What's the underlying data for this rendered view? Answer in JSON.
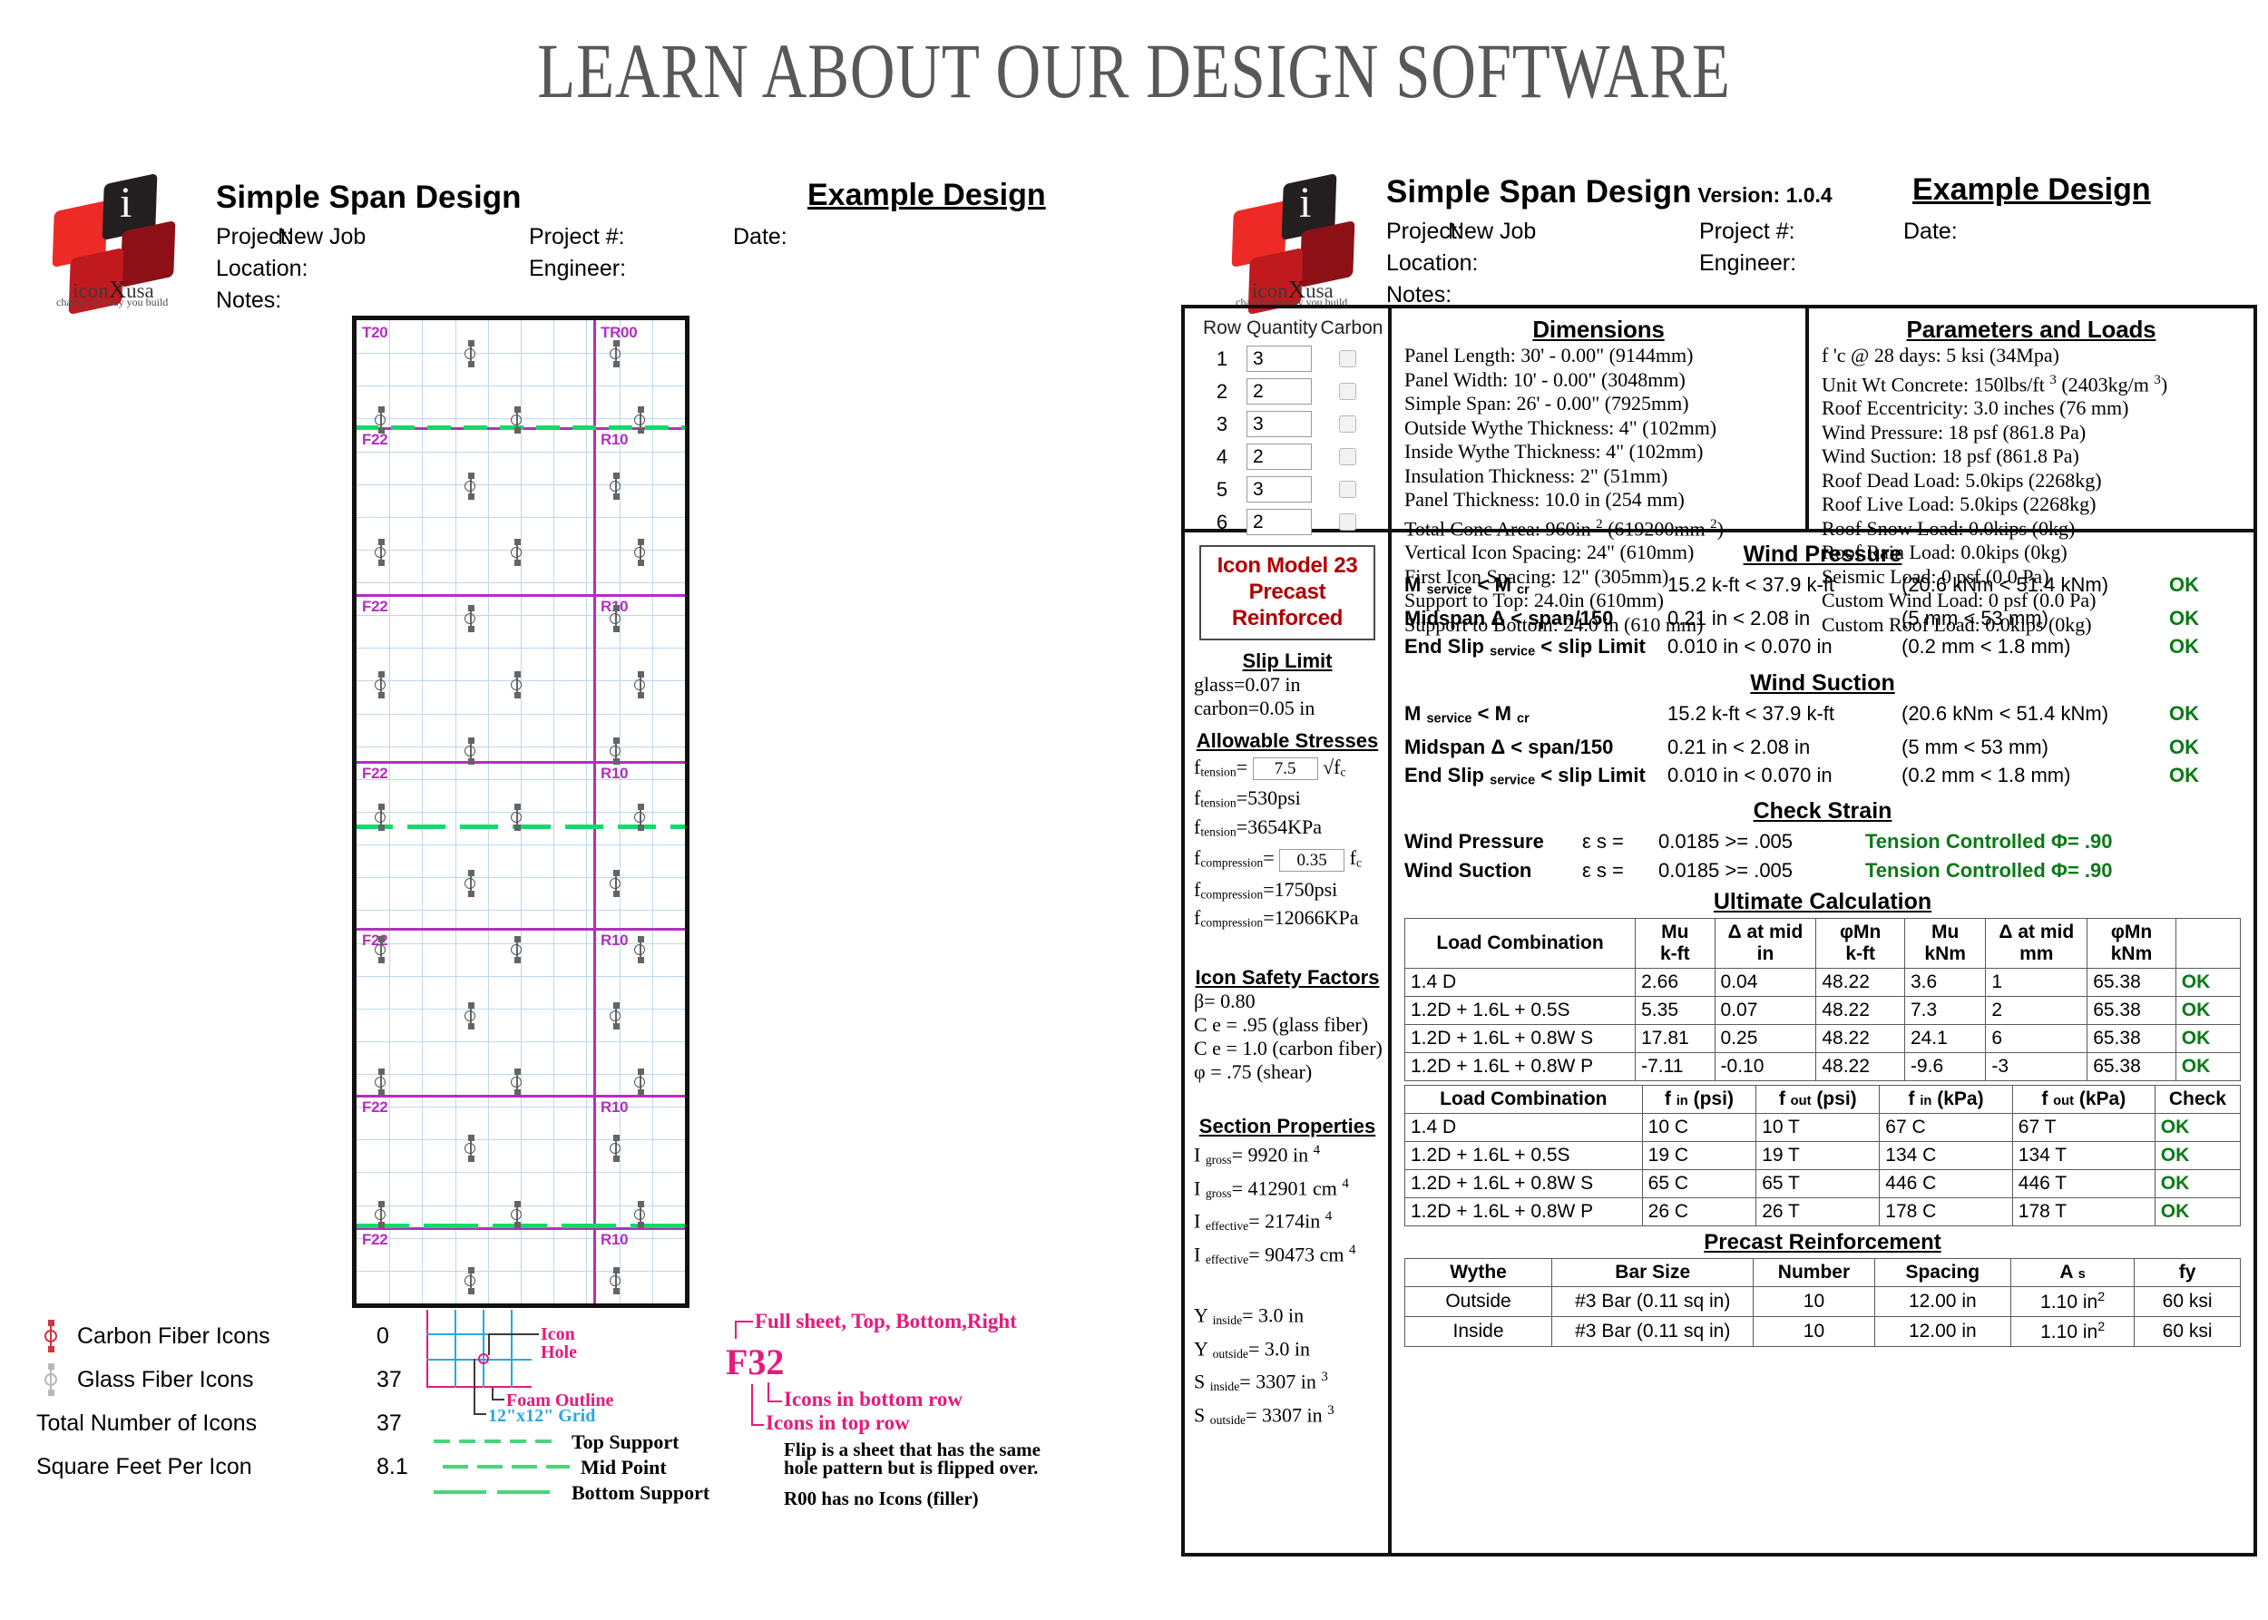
{
  "page_title": "LEARN ABOUT OUR DESIGN SOFTWARE",
  "logo": {
    "brand_pre": "icon",
    "brand_x": "X",
    "brand_post": "usa",
    "tagline": "change the way you build",
    "letter": "i"
  },
  "header_left": {
    "title": "Simple Span Design",
    "project_label": "Project:",
    "project_value": "New Job",
    "project_no_label": "Project #:",
    "project_no_value": "",
    "date_label": "Date:",
    "date_value": "",
    "location_label": "Location:",
    "location_value": "",
    "engineer_label": "Engineer:",
    "engineer_value": "",
    "notes_label": "Notes:",
    "example": "Example Design"
  },
  "header_right": {
    "title": "Simple Span Design",
    "version": "Version: 1.0.4",
    "project_label": "Project:",
    "project_value": "New Job",
    "project_no_label": "Project #:",
    "date_label": "Date:",
    "location_label": "Location:",
    "engineer_label": "Engineer:",
    "notes_label": "Notes:",
    "example": "Example Design"
  },
  "panel_drawing": {
    "sheet_labels_left": [
      "T20",
      "F22",
      "F22",
      "F22",
      "F22",
      "F22",
      "F22"
    ],
    "sheet_labels_right": [
      "TR00",
      "R10",
      "R10",
      "R10",
      "R10",
      "R10",
      "R10"
    ],
    "supports": [
      "Top Support",
      "Mid Point",
      "Bottom Support"
    ],
    "grid_color": "#bcd7f0",
    "sheet_color": "#b52ec0",
    "support_color": "#14d96a"
  },
  "icon_legend": {
    "rows": [
      {
        "name": "Carbon Fiber Icons",
        "value": "0",
        "color": "#d1343f",
        "icon": "carbon-icon"
      },
      {
        "name": "Glass Fiber Icons",
        "value": "37",
        "color": "#b9b9b9",
        "icon": "glass-icon"
      },
      {
        "name": "Total Number of Icons",
        "value": "37",
        "color": "",
        "icon": ""
      },
      {
        "name": "Square Feet Per Icon",
        "value": "8.1",
        "color": "",
        "icon": ""
      }
    ]
  },
  "legend_diagram": {
    "icon_hole": [
      "Icon",
      "Hole"
    ],
    "foam_outline": "Foam Outline",
    "grid_label": "12\"x12\" Grid",
    "supports": [
      {
        "label": "Top Support",
        "style": "dashed-short"
      },
      {
        "label": "Mid Point",
        "style": "dashed-mid"
      },
      {
        "label": "Bottom Support",
        "style": "dashed-long"
      }
    ]
  },
  "code_legend": {
    "top_note": "Full sheet, Top, Bottom,Right",
    "code": "F32",
    "bottom_row_note": "Icons in bottom row",
    "top_row_note": "Icons in top row",
    "flip_note_l1": "Flip is a sheet that has the same",
    "flip_note_l2": "hole pattern but is flipped over.",
    "filler_note": "R00 has no Icons (filler)"
  },
  "row_table": {
    "headers": [
      "Row",
      "Quantity",
      "Carbon"
    ],
    "rows": [
      {
        "row": "1",
        "quantity": "3",
        "carbon": false
      },
      {
        "row": "2",
        "quantity": "2",
        "carbon": false
      },
      {
        "row": "3",
        "quantity": "3",
        "carbon": false
      },
      {
        "row": "4",
        "quantity": "2",
        "carbon": false
      },
      {
        "row": "5",
        "quantity": "3",
        "carbon": false
      },
      {
        "row": "6",
        "quantity": "2",
        "carbon": false
      }
    ]
  },
  "dimensions": {
    "title": "Dimensions",
    "lines": [
      "Panel Length: 30' - 0.00\" (9144mm)",
      "Panel Width: 10' - 0.00\" (3048mm)",
      "Simple Span: 26' - 0.00\" (7925mm)",
      "Outside Wythe Thickness: 4\" (102mm)",
      "Inside Wythe Thickness: 4\" (102mm)",
      "Insulation Thickness: 2\" (51mm)",
      "Panel Thickness: 10.0 in (254 mm)",
      "Vertical Icon Spacing: 24\" (610mm)",
      "First Icon Spacing: 12\" (305mm)",
      "Support to Top: 24.0in (610mm)",
      "Support to Bottom: 24.0 in (610 mm)"
    ],
    "total_conc_area": {
      "pre": "Total Conc Area: 960in ",
      "sup1": "2",
      "mid": " (619200mm ",
      "sup2": "2",
      "post": ")"
    }
  },
  "parameters": {
    "title": "Parameters and Loads",
    "lines": [
      "f 'c @ 28 days: 5 ksi (34Mpa)",
      "Roof Eccentricity: 3.0 inches (76 mm)",
      "Wind Pressure: 18 psf (861.8 Pa)",
      "Wind Suction: 18 psf (861.8 Pa)",
      "Roof Dead Load: 5.0kips (2268kg)",
      "Roof Live Load: 5.0kips (2268kg)",
      "Roof Snow Load: 0.0kips (0kg)",
      "Roof Rain Load: 0.0kips (0kg)",
      "Seismic Load: 0 psf (0.0 Pa)",
      "Custom Wind Load: 0 psf (0.0 Pa)",
      "Custom Roof Load: 0.0kips (0kg)"
    ],
    "unit_wt": {
      "pre": "Unit Wt Concrete: 150lbs/ft ",
      "sup1": "3",
      "mid": " (2403kg/m ",
      "sup2": "3",
      "post": ")"
    }
  },
  "model": {
    "line1": "Icon Model 23",
    "line2": "Precast Reinforced"
  },
  "slip_limit": {
    "title": "Slip Limit",
    "glass": "glass=0.07 in",
    "carbon": "carbon=0.05 in"
  },
  "allowable_stresses": {
    "title": "Allowable Stresses",
    "f_tension_label": "f",
    "f_tension_sub": "tension",
    "f_tension_eq": "=",
    "f_tension_value": "7.5",
    "f_tension_unit": "√f",
    "f_tension_unit_sub": "c",
    "f_tension_psi": "=530psi",
    "f_tension_kpa": "=3654KPa",
    "f_comp_value": "0.35",
    "f_comp_unit": "f",
    "f_comp_unit_sub": "c",
    "f_comp_psi": "=1750psi",
    "f_comp_kpa": "=12066KPa",
    "sub_tension": "tension",
    "sub_compression": "compression"
  },
  "safety_factors": {
    "title": "Icon Safety Factors",
    "lines": [
      "β= 0.80",
      "C e = .95 (glass fiber)",
      "C e = 1.0 (carbon fiber)",
      "φ = .75 (shear)"
    ]
  },
  "section_properties": {
    "title": "Section Properties",
    "items": [
      {
        "sym": "I",
        "sub": "gross",
        "val": "= 9920 in ",
        "sup": "4"
      },
      {
        "sym": "I",
        "sub": "gross",
        "val": "= 412901 cm ",
        "sup": "4"
      },
      {
        "sym": "I",
        "sub": "effective",
        "val": "= 2174in ",
        "sup": "4"
      },
      {
        "sym": "I",
        "sub": "effective",
        "val": "= 90473 cm ",
        "sup": "4"
      }
    ],
    "items2": [
      {
        "sym": "Y",
        "sub": "inside",
        "val": "= 3.0 in",
        "sup": ""
      },
      {
        "sym": "Y",
        "sub": "outside",
        "val": "= 3.0 in",
        "sup": ""
      },
      {
        "sym": "S",
        "sub": "inside",
        "val": "= 3307 in ",
        "sup": "3"
      },
      {
        "sym": "S",
        "sub": "outside",
        "val": "= 3307 in ",
        "sup": "3"
      }
    ]
  },
  "wind_pressure": {
    "title": "Wind Pressure",
    "rows": [
      {
        "check": "M service < M cr",
        "imperial": "15.2 k-ft < 37.9 k-ft",
        "metric": "(20.6 kNm < 51.4 kNm)",
        "status": "OK"
      },
      {
        "check": "Midspan Δ < span/150",
        "imperial": "0.21 in < 2.08 in",
        "metric": "(5 mm < 53 mm)",
        "status": "OK"
      },
      {
        "check": "End Slip service < slip Limit",
        "imperial": "0.010 in < 0.070 in",
        "metric": "(0.2 mm < 1.8 mm)",
        "status": "OK"
      }
    ]
  },
  "wind_suction": {
    "title": "Wind Suction",
    "rows": [
      {
        "check": "M service < M cr",
        "imperial": "15.2 k-ft < 37.9 k-ft",
        "metric": "(20.6 kNm < 51.4 kNm)",
        "status": "OK"
      },
      {
        "check": "Midspan Δ < span/150",
        "imperial": "0.21 in < 2.08 in",
        "metric": "(5 mm < 53 mm)",
        "status": "OK"
      },
      {
        "check": "End Slip service < slip Limit",
        "imperial": "0.010 in < 0.070 in",
        "metric": "(0.2 mm < 1.8 mm)",
        "status": "OK"
      }
    ]
  },
  "check_strain": {
    "title": "Check Strain",
    "rows": [
      {
        "name": "Wind Pressure",
        "eps": "ε s =",
        "value": "0.0185 >= .005",
        "result": "Tension Controlled Φ= .90"
      },
      {
        "name": "Wind Suction",
        "eps": "ε s =",
        "value": "0.0185 >= .005",
        "result": "Tension Controlled Φ= .90"
      }
    ]
  },
  "ultimate_calculation": {
    "title": "Ultimate Calculation",
    "headers": [
      "Load Combination",
      "Mu|k-ft",
      "Δ at mid|in",
      "φMn|k-ft",
      "Mu|kNm",
      "Δ at mid|mm",
      "φMn|kNm",
      ""
    ],
    "rows": [
      [
        "1.4 D",
        "2.66",
        "0.04",
        "48.22",
        "3.6",
        "1",
        "65.38",
        "OK"
      ],
      [
        "1.2D + 1.6L + 0.5S",
        "5.35",
        "0.07",
        "48.22",
        "7.3",
        "2",
        "65.38",
        "OK"
      ],
      [
        "1.2D + 1.6L + 0.8W S",
        "17.81",
        "0.25",
        "48.22",
        "24.1",
        "6",
        "65.38",
        "OK"
      ],
      [
        "1.2D + 1.6L + 0.8W P",
        "-7.11",
        "-0.10",
        "48.22",
        "-9.6",
        "-3",
        "65.38",
        "OK"
      ]
    ]
  },
  "stress_table": {
    "headers": [
      "Load Combination",
      "f in (psi)",
      "f out (psi)",
      "f in (kPa)",
      "f out (kPa)",
      "Check"
    ],
    "rows": [
      [
        "1.4 D",
        "10 C",
        "10 T",
        "67 C",
        "67 T",
        "OK"
      ],
      [
        "1.2D + 1.6L + 0.5S",
        "19 C",
        "19 T",
        "134 C",
        "134 T",
        "OK"
      ],
      [
        "1.2D + 1.6L + 0.8W S",
        "65 C",
        "65 T",
        "446 C",
        "446 T",
        "OK"
      ],
      [
        "1.2D + 1.6L + 0.8W P",
        "26 C",
        "26 T",
        "178 C",
        "178 T",
        "OK"
      ]
    ]
  },
  "precast_reinforcement": {
    "title": "Precast Reinforcement",
    "headers": [
      "Wythe",
      "Bar Size",
      "Number",
      "Spacing",
      "A s",
      "fy"
    ],
    "rows": [
      [
        "Outside",
        "#3 Bar (0.11 sq in)",
        "10",
        "12.00 in",
        "1.10 in",
        "60 ksi"
      ],
      [
        "Inside",
        "#3 Bar (0.11 sq in)",
        "10",
        "12.00 in",
        "1.10 in",
        "60 ksi"
      ]
    ]
  }
}
